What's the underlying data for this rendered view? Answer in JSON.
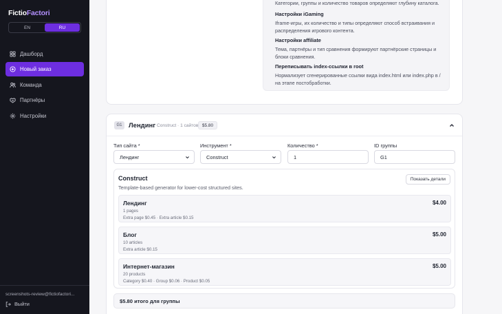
{
  "sidebar": {
    "logo_main": "Fictio",
    "logo_accent": "Factori",
    "languages": [
      {
        "label": "EN",
        "active": false
      },
      {
        "label": "RU",
        "active": true
      }
    ],
    "nav": [
      {
        "label": "Дашборд",
        "icon": "dashboard-icon",
        "active": false
      },
      {
        "label": "Новый заказ",
        "icon": "plus-circle-icon",
        "active": true
      },
      {
        "label": "Команда",
        "icon": "users-icon",
        "active": false
      },
      {
        "label": "Партнёры",
        "icon": "handshake-icon",
        "active": false
      },
      {
        "label": "Настройки",
        "icon": "gear-icon",
        "active": false
      }
    ],
    "user_email": "screenshots-review@fictiofactori...",
    "logout_label": "Выйти"
  },
  "settings_panel": {
    "top_text": "Категории, группы и количество товаров определяют глубину каталога.",
    "items": [
      {
        "title": "Настройки iGaming",
        "desc_1": "Iframe-игры, их количество и типы определяют способ встраивания и",
        "desc_2": "распределения игрового контента."
      },
      {
        "title": "Настройки affiliate",
        "desc_1": "Тема, партнёры и тип сравнения формируют партнёрские страницы и",
        "desc_2": "блоки сравнения."
      },
      {
        "title": "Переписывать index-ссылки в root",
        "desc_1": "Нормализует сгенерированные ссылки вида index.html или index.php в /",
        "desc_2": "на этапе постобработки."
      }
    ]
  },
  "landing": {
    "group_badge": "G1",
    "title": "Лендинг",
    "subtitle": "Construct · 1 сайтов",
    "price_badge": "$5.80",
    "fields": {
      "site_type_label": "Тип сайта *",
      "site_type_value": "Лендинг",
      "tool_label": "Инструмент *",
      "tool_value": "Construct",
      "quantity_label": "Количество *",
      "quantity_value": "1",
      "group_id_label": "ID группы",
      "group_id_value": "G1"
    },
    "construct": {
      "title": "Construct",
      "subtitle": "Template-based generator for lower-cost structured sites.",
      "details_button": "Показать детали",
      "options": [
        {
          "name": "Лендинг",
          "price": "$4.00",
          "meta": "1 pages",
          "extra": "Extra page $0.45 · Extra article $0.15"
        },
        {
          "name": "Блог",
          "price": "$5.00",
          "meta": "10 articles",
          "extra": "Extra article $0.15"
        },
        {
          "name": "Интернет-магазин",
          "price": "$5.00",
          "meta": "20 products",
          "extra": "Category $0.40 · Group $0.06 · Product $0.05"
        }
      ]
    },
    "total": "$5.80 итого для группы"
  },
  "colors": {
    "accent": "#6d2ee0",
    "sidebar_bg": "#15161e"
  }
}
